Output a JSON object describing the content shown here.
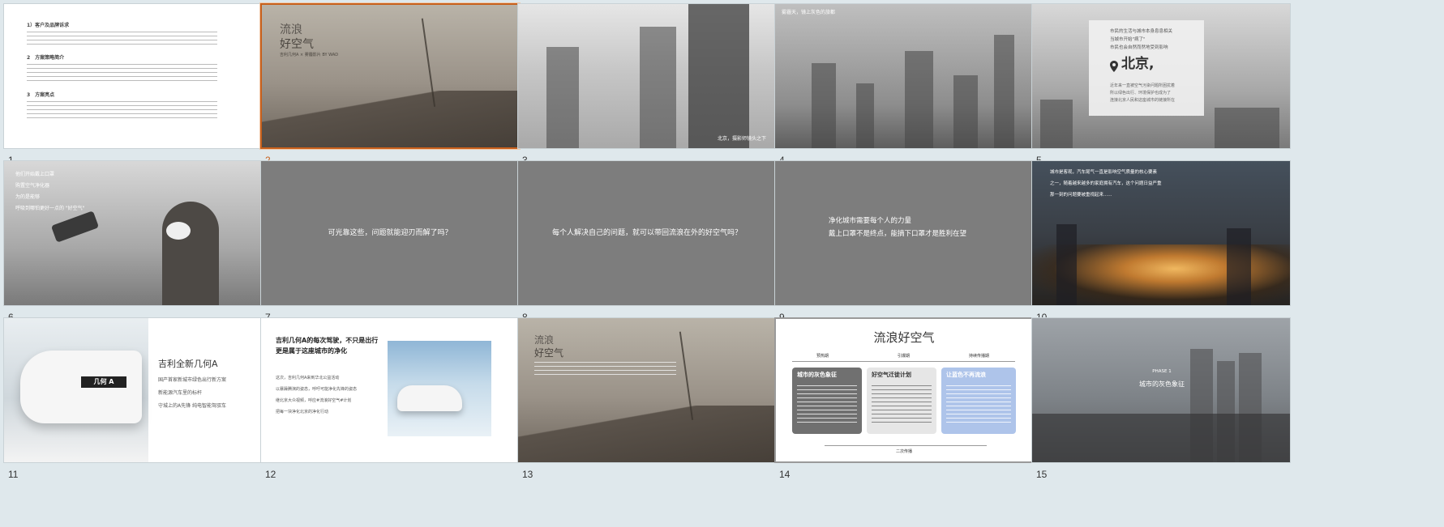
{
  "slides": [
    {
      "num": "1",
      "lines": [
        "1）客户及品牌诉求",
        "2　方案策略简介",
        "3　方案亮点"
      ]
    },
    {
      "num": "2",
      "title1": "流浪",
      "title2": "好空气",
      "sub": "吉利几何A × 雾霾影片 BY WAD"
    },
    {
      "num": "3",
      "caption": "北京，摄影师镜头之下"
    },
    {
      "num": "4",
      "caption": "雾霾天，镜上灰色的旅都"
    },
    {
      "num": "5",
      "lines": [
        "市民的生活与城市本身息息相关",
        "当城市开始\"病了\"",
        "市民也会自然而然地受到影响"
      ],
      "city": "北京,",
      "body": [
        "近年来一直被空气污染问题所困扰着",
        "所以绿色出行、环境保护也成为了",
        "连接北京人民和这座城市的链接所在"
      ]
    },
    {
      "num": "6",
      "lines": [
        "他们开始戴上口罩",
        "购置空气净化器",
        "为的是能够",
        "呼吸到哪怕更好一点的 \"好空气\""
      ]
    },
    {
      "num": "7",
      "text": "可光靠这些，问题就能迎刃而解了吗？"
    },
    {
      "num": "8",
      "text": "每个人解决自己的问题，就可以带回流浪在外的好空气吗？"
    },
    {
      "num": "9",
      "lines": [
        "净化城市需要每个人的力量",
        "戴上口罩不是终点，能摘下口罩才是胜利在望"
      ]
    },
    {
      "num": "10",
      "lines": [
        "城市是客观，汽车尾气一直是影响空气质量的核心要素",
        "之一，随着越来越多的家庭拥有汽车，这个问题日益严重",
        "那一刻的问题要被重视起来......"
      ]
    },
    {
      "num": "11",
      "title": "吉利全新几何A",
      "lines": [
        "国产首家新城市绿色出行新方案",
        "新能源汽车里的标杆",
        "守城上的A先锋 纯电智能驾驭车"
      ],
      "plate": "几何 A"
    },
    {
      "num": "12",
      "title": "吉利几何A的每次驾驶，不只是出行 更是属于这座城市的净化",
      "lines": [
        "这次，吉利几何A来到华北公益活动",
        "以暴躁腾演的姿态，呼吁可能净化先锋的姿态",
        "继北京大众视频，呼应#流浪好空气#计划",
        "把每一块净化北京的净化行动"
      ]
    },
    {
      "num": "13",
      "title1": "流浪",
      "title2": "好空气"
    },
    {
      "num": "14",
      "title": "流浪好空气",
      "cols": [
        "预热期",
        "引爆期",
        "持续传播期"
      ],
      "cards": [
        "城市的灰色象征",
        "好空气迁徙计划",
        "让蓝色不再流浪"
      ],
      "footer": "二次传播"
    },
    {
      "num": "15",
      "phase": "PHASE 1",
      "text": "城市的灰色象征"
    }
  ]
}
